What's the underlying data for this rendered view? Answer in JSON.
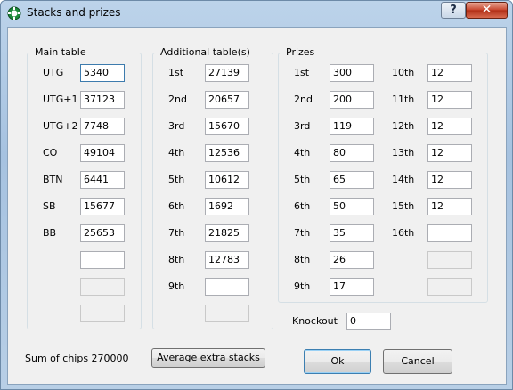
{
  "window": {
    "title": "Stacks and prizes",
    "help_label": "?",
    "close_label": "✕"
  },
  "main_table": {
    "title": "Main table",
    "rows": [
      {
        "label": "UTG",
        "value": "5340"
      },
      {
        "label": "UTG+1",
        "value": "37123"
      },
      {
        "label": "UTG+2",
        "value": "7748"
      },
      {
        "label": "CO",
        "value": "49104"
      },
      {
        "label": "BTN",
        "value": "6441"
      },
      {
        "label": "SB",
        "value": "15677"
      },
      {
        "label": "BB",
        "value": "25653"
      }
    ],
    "extra_value": ""
  },
  "additional_tables": {
    "title": "Additional table(s)",
    "rows": [
      {
        "label": "1st",
        "value": "27139"
      },
      {
        "label": "2nd",
        "value": "20657"
      },
      {
        "label": "3rd",
        "value": "15670"
      },
      {
        "label": "4th",
        "value": "12536"
      },
      {
        "label": "5th",
        "value": "10612"
      },
      {
        "label": "6th",
        "value": "1692"
      },
      {
        "label": "7th",
        "value": "21825"
      },
      {
        "label": "8th",
        "value": "12783"
      },
      {
        "label": "9th",
        "value": ""
      }
    ]
  },
  "prizes": {
    "title": "Prizes",
    "left": [
      {
        "label": "1st",
        "value": "300"
      },
      {
        "label": "2nd",
        "value": "200"
      },
      {
        "label": "3rd",
        "value": "119"
      },
      {
        "label": "4th",
        "value": "80"
      },
      {
        "label": "5th",
        "value": "65"
      },
      {
        "label": "6th",
        "value": "50"
      },
      {
        "label": "7th",
        "value": "35"
      },
      {
        "label": "8th",
        "value": "26"
      },
      {
        "label": "9th",
        "value": "17"
      }
    ],
    "right": [
      {
        "label": "10th",
        "value": "12"
      },
      {
        "label": "11th",
        "value": "12"
      },
      {
        "label": "12th",
        "value": "12"
      },
      {
        "label": "13th",
        "value": "12"
      },
      {
        "label": "14th",
        "value": "12"
      },
      {
        "label": "15th",
        "value": "12"
      },
      {
        "label": "16th",
        "value": ""
      }
    ]
  },
  "knockout": {
    "label": "Knockout",
    "value": "0"
  },
  "footer": {
    "sum_label": "Sum of chips 270000",
    "average_button": "Average extra stacks",
    "ok_button": "Ok",
    "cancel_button": "Cancel"
  }
}
